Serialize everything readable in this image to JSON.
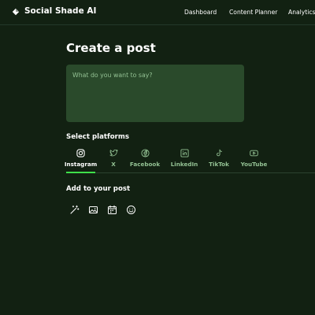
{
  "header": {
    "brand": "Social Shade AI",
    "logo_icon": "logo-icon",
    "nav": [
      {
        "label": "Dashboard"
      },
      {
        "label": "Content Planner"
      },
      {
        "label": "Analytics"
      }
    ]
  },
  "main": {
    "title": "Create a post",
    "composer": {
      "value": "",
      "placeholder": "What do you want to say?"
    },
    "platforms_title": "Select platforms",
    "platforms": [
      {
        "label": "Instagram",
        "icon": "instagram-icon",
        "active": true
      },
      {
        "label": "X",
        "icon": "x-twitter-icon",
        "active": false
      },
      {
        "label": "Facebook",
        "icon": "facebook-icon",
        "active": false
      },
      {
        "label": "LinkedIn",
        "icon": "linkedin-icon",
        "active": false
      },
      {
        "label": "TikTok",
        "icon": "tiktok-icon",
        "active": false
      },
      {
        "label": "YouTube",
        "icon": "youtube-icon",
        "active": false
      }
    ],
    "add_title": "Add to your post",
    "tools": [
      {
        "icon": "magic-wand-icon"
      },
      {
        "icon": "image-icon"
      },
      {
        "icon": "calendar-icon"
      },
      {
        "icon": "emoji-icon"
      }
    ]
  },
  "colors": {
    "background": "#122112",
    "composer_bg": "#2a4a2b",
    "muted_text": "#93c193",
    "accent": "#3fe04a"
  }
}
